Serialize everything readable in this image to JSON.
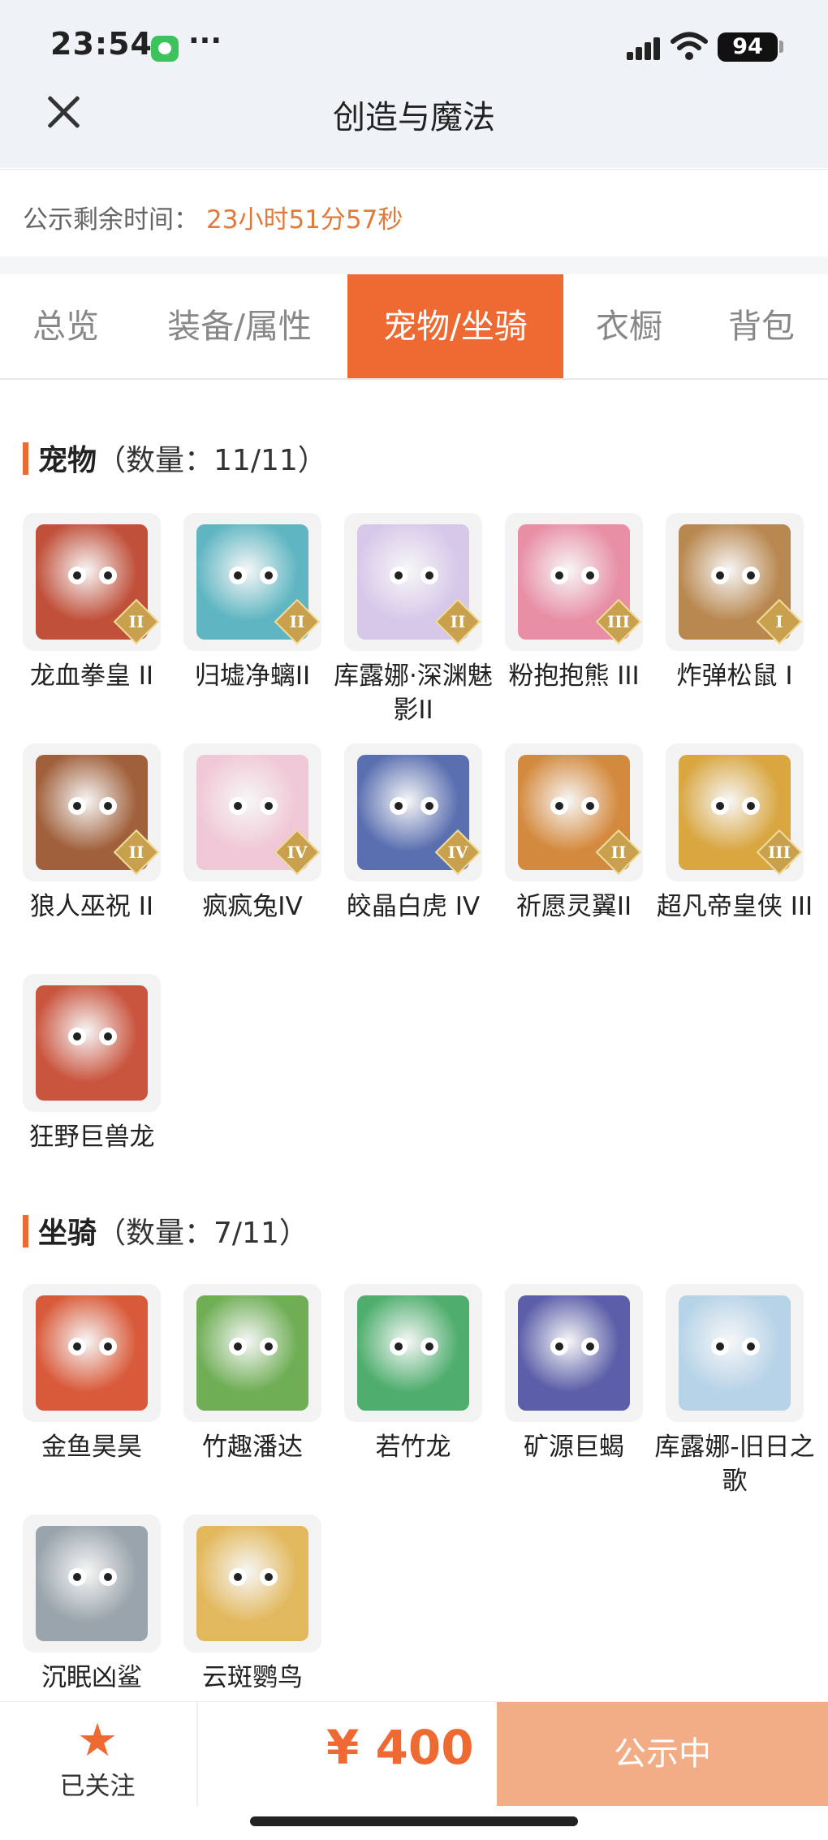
{
  "status_bar": {
    "time": "23:54",
    "dots": "···",
    "battery": "94"
  },
  "header": {
    "title": "创造与魔法"
  },
  "timer": {
    "label": "公示剩余时间：",
    "value": "23小时51分57秒"
  },
  "tabs": [
    {
      "label": "总览",
      "active": false
    },
    {
      "label": "装备/属性",
      "active": false
    },
    {
      "label": "宠物/坐骑",
      "active": true
    },
    {
      "label": "衣橱",
      "active": false
    },
    {
      "label": "背包",
      "active": false
    }
  ],
  "pets": {
    "title": "宠物",
    "count": "（数量：11/11）",
    "items": [
      {
        "name": "龙血拳皇 II",
        "badge": "II",
        "color": "#c0503a"
      },
      {
        "name": "归墟净螭II",
        "badge": "II",
        "color": "#5fb6c2"
      },
      {
        "name": "库露娜·深渊魅影II",
        "badge": "II",
        "color": "#d7c8ea"
      },
      {
        "name": "粉抱抱熊 III",
        "badge": "III",
        "color": "#e88fa6"
      },
      {
        "name": "炸弹松鼠 I",
        "badge": "I",
        "color": "#b98850"
      },
      {
        "name": "狼人巫祝 II",
        "badge": "II",
        "color": "#a0603b"
      },
      {
        "name": "疯疯兔IV",
        "badge": "IV",
        "color": "#f0c7d6"
      },
      {
        "name": "皎晶白虎 IV",
        "badge": "IV",
        "color": "#5a6fb0"
      },
      {
        "name": "祈愿灵翼II",
        "badge": "II",
        "color": "#d48a3e"
      },
      {
        "name": "超凡帝皇侠 III",
        "badge": "III",
        "color": "#d9a640"
      },
      {
        "name": "狂野巨兽龙",
        "badge": "",
        "color": "#c9553f"
      }
    ]
  },
  "mounts": {
    "title": "坐骑",
    "count": "（数量：7/11）",
    "items": [
      {
        "name": "金鱼昊昊",
        "color": "#d95a3a"
      },
      {
        "name": "竹趣潘达",
        "color": "#6fae55"
      },
      {
        "name": "若竹龙",
        "color": "#4fae6e"
      },
      {
        "name": "矿源巨蝎",
        "color": "#5b5ea8"
      },
      {
        "name": "库露娜-旧日之歌",
        "color": "#b7d3e8"
      },
      {
        "name": "沉眠凶鲨",
        "color": "#9aa4ac"
      },
      {
        "name": "云斑鹦鸟",
        "color": "#e2b85c"
      }
    ]
  },
  "bottom_bar": {
    "follow_label": "已关注",
    "price": "¥ 400",
    "status_button": "公示中"
  },
  "colors": {
    "accent": "#ee6a32",
    "timer": "#e07a3a",
    "button_disabled": "#f2ad86"
  }
}
